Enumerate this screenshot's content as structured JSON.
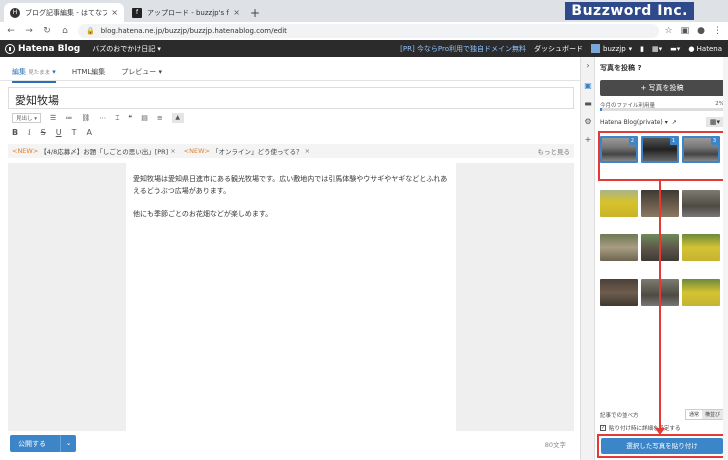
{
  "browser": {
    "tabs": [
      {
        "title": "ブログ記事編集 - はてなブログ",
        "active": true
      },
      {
        "title": "アップロード - buzzjp's fotolife",
        "active": false
      }
    ],
    "new_tab": "+",
    "watermark": "Buzzword Inc.",
    "url": "blog.hatena.ne.jp/buzzjp/buzzjp.hatenablog.com/edit"
  },
  "header": {
    "logo": "Hatena Blog",
    "blog_name": "バズのおでかけ日記",
    "pro_link": "[PR] 今ならPro利用で独自ドメイン無料",
    "dashboard": "ダッシュボード",
    "user": "buzzjp",
    "brand": "Hatena"
  },
  "editor": {
    "mode_tabs": [
      {
        "label": "編集",
        "sub": "見たまま",
        "active": true
      },
      {
        "label": "HTML編集",
        "sub": "",
        "active": false
      },
      {
        "label": "プレビュー",
        "sub": "",
        "active": false
      }
    ],
    "title": "愛知牧場",
    "heading_select": "見出し",
    "notices": [
      {
        "tag": "<NEW>",
        "text": "【4/8応募〆】お題「しごとの思い出」[PR]"
      },
      {
        "tag": "<NEW>",
        "text": "「オンライン」どう使ってる？"
      }
    ],
    "more": "もっと見る",
    "body": [
      "愛知牧場は愛知県日進市にある観光牧場です。広い敷地内では引馬体験やウサギやヤギなどとふれあえるどうぶつ広場があります。",
      "他にも季節ごとのお花畑などが楽しめます。"
    ],
    "publish_label": "公開する",
    "char_count": "80文字"
  },
  "photo_panel": {
    "title": "写真を投稿",
    "upload_button": "写真を投稿",
    "usage_label": "今月のファイル利用量",
    "usage_percent": "2%",
    "usage_fraction": 0.02,
    "album": "Hatena Blog(private)",
    "thumbs": [
      {
        "style": "t-bw",
        "selected": true,
        "badge": "2"
      },
      {
        "style": "t-dark",
        "selected": true,
        "badge": "1"
      },
      {
        "style": "t-bw",
        "selected": true,
        "badge": "3"
      },
      {
        "style": "t-field",
        "selected": false,
        "badge": ""
      },
      {
        "style": "t-animal",
        "selected": false,
        "badge": ""
      },
      {
        "style": "t-pen",
        "selected": false,
        "badge": ""
      },
      {
        "style": "t-sheep",
        "selected": false,
        "badge": ""
      },
      {
        "style": "t-green",
        "selected": false,
        "badge": ""
      },
      {
        "style": "t-yellow",
        "selected": false,
        "badge": ""
      },
      {
        "style": "t-brown",
        "selected": false,
        "badge": ""
      },
      {
        "style": "t-pen",
        "selected": false,
        "badge": ""
      },
      {
        "style": "t-yellow",
        "selected": false,
        "badge": ""
      }
    ],
    "sort_label": "記事での並べ方",
    "sort_options": [
      {
        "label": "通常",
        "active": false
      },
      {
        "label": "横並び",
        "active": true
      }
    ],
    "detail_setting": "貼り付け時に詳細を設定する",
    "paste_button": "選択した写真を貼り付け"
  },
  "colors": {
    "accent": "#3b85c8",
    "highlight": "#e53935",
    "header_bg": "#2b2b2b"
  }
}
